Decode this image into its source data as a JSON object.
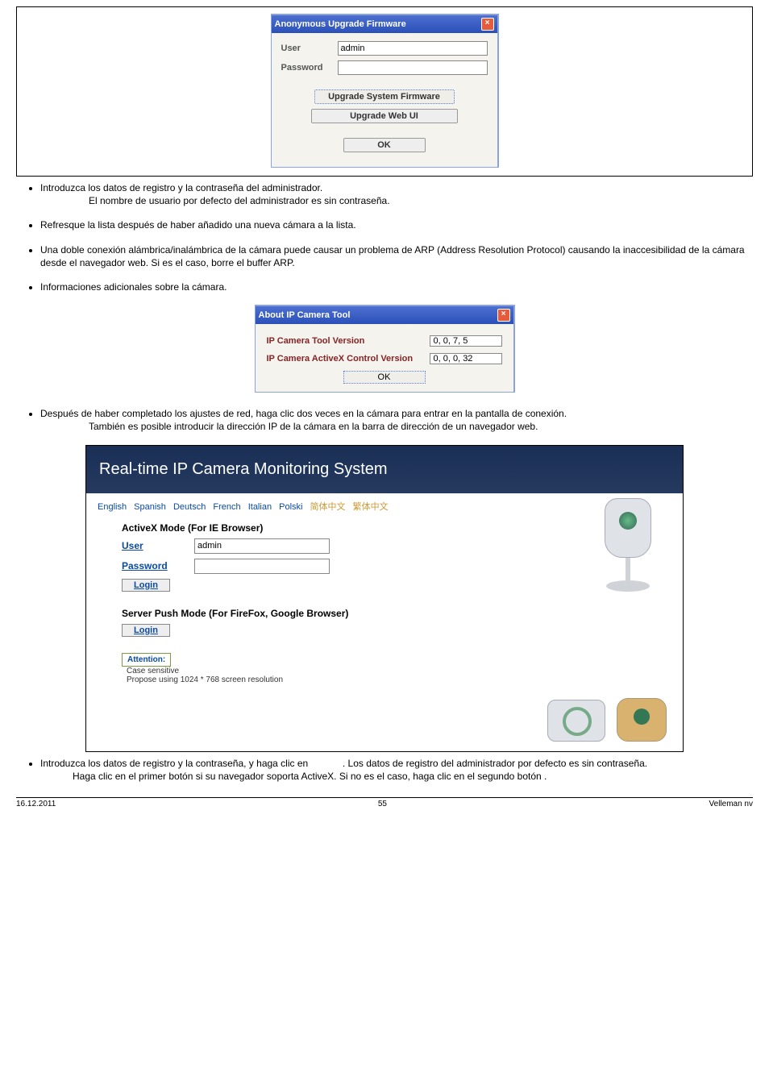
{
  "dialog1": {
    "title": "Anonymous Upgrade Firmware",
    "user_label": "User",
    "user_value": "admin",
    "pass_label": "Password",
    "pass_value": "",
    "btn_sys": "Upgrade System Firmware",
    "btn_web": "Upgrade Web UI",
    "btn_ok": "OK"
  },
  "bullets1": {
    "b1": "Introduzca los datos de registro y la contraseña del administrador.",
    "b1_sub": "El nombre de usuario por defecto del administrador es           sin contraseña.",
    "b2": "Refresque la lista después de haber añadido una nueva cámara a la lista.",
    "b3": "Una doble conexión alámbrica/inalámbrica de la cámara puede causar un problema de ARP (Address Resolution Protocol) causando la inaccesibilidad de la cámara desde el navegador web. Si es el caso, borre el buffer ARP.",
    "b4": "Informaciones adicionales sobre la cámara."
  },
  "about": {
    "title": "About IP Camera Tool",
    "r1_lbl": "IP Camera Tool Version",
    "r1_val": "0, 0, 7, 5",
    "r2_lbl": "IP Camera ActiveX Control Version",
    "r2_val": "0, 0, 0, 32",
    "ok": "OK"
  },
  "bullets2": {
    "b5": "Después de haber completado los ajustes de red, haga clic dos veces en la cámara para entrar en la pantalla de conexión.",
    "b5_sub": "También es posible introducir la dirección IP de la cámara en la barra de dirección de un navegador web."
  },
  "monitor": {
    "header": "Real-time IP Camera Monitoring System",
    "langs": {
      "en": "English",
      "es": "Spanish",
      "de": "Deutsch",
      "fr": "French",
      "it": "Italian",
      "pl": "Polski",
      "cn1": "简体中文",
      "cn2": "繁体中文"
    },
    "sec1": "ActiveX Mode (For IE Browser)",
    "user_lbl": "User",
    "user_val": "admin",
    "pass_lbl": "Password",
    "login": "Login",
    "sec2": "Server Push Mode (For FireFox, Google Browser)",
    "attn": "Attention:",
    "attn1": "Case sensitive",
    "attn2": "Propose using 1024 * 768 screen resolution"
  },
  "bullets3": {
    "b6a": "Introduzca los datos de registro y la contraseña, y haga clic en",
    "b6b": ". Los datos de registro del administrador por defecto es           sin contraseña.",
    "b6c": "Haga clic en el primer botón           si su navegador soporta ActiveX. Si no es el caso, haga clic en el segundo botón       ."
  },
  "footer": {
    "left": "16.12.2011",
    "center": "55",
    "right": "Velleman nv"
  }
}
